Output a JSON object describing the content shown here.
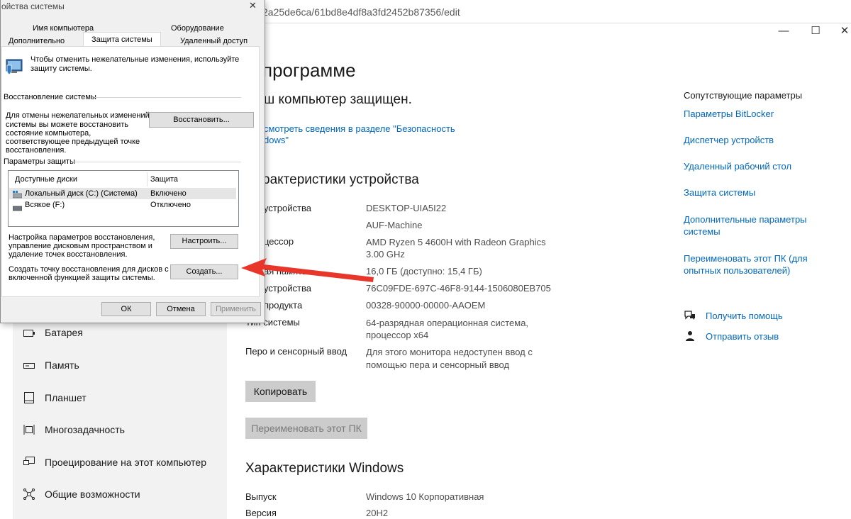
{
  "browser": {
    "url_fragment": "2a25de6ca/61bd8e4df8a3fd2452b87356/edit"
  },
  "window_controls": {
    "minimize": "—",
    "maximize": "☐",
    "close": "✕"
  },
  "about": {
    "title": "программе",
    "protected": "ш компьютер защищен.",
    "security_link_line1": "смотреть сведения в разделе \"Безопасность",
    "security_link_line2": "dows\"",
    "device_specs_title": "рактеристики устройства",
    "specs": [
      {
        "label": "устройства",
        "value": "DESKTOP-UIA5I22"
      },
      {
        "label": "",
        "value": "AUF-Machine"
      },
      {
        "label": "цессор",
        "value": "AMD Ryzen 5 4600H with Radeon Graphics"
      },
      {
        "label": "",
        "value": "3.00 GHz"
      },
      {
        "label": "ая память",
        "value": "16,0 ГБ (доступно: 15,4 ГБ)"
      },
      {
        "label": "устройства",
        "value": "76C09FDE-697C-46F8-9144-1506080EB705"
      },
      {
        "label": "продукта",
        "value": "00328-90000-00000-AAOEM"
      },
      {
        "label": "Тип системы",
        "value": "64-разрядная операционная система,"
      },
      {
        "label": "",
        "value": "процессор x64"
      },
      {
        "label": "Перо и сенсорный ввод",
        "value": "Для этого монитора недоступен ввод с"
      },
      {
        "label": "",
        "value": "помощью пера и сенсорный ввод"
      }
    ],
    "copy_button": "Копировать",
    "rename_button": "Переименовать этот ПК",
    "windows_specs_title": "Характеристики Windows",
    "winspecs": [
      {
        "label": "Выпуск",
        "value": "Windows 10 Корпоративная"
      },
      {
        "label": "Версия",
        "value": "20H2"
      }
    ]
  },
  "related": {
    "title": "Сопутствующие параметры",
    "links": [
      "Параметры BitLocker",
      "Диспетчер устройств",
      "Удаленный рабочий стол",
      "Защита системы",
      "Дополнительные параметры",
      "системы",
      "Переименовать этот ПК (для",
      "опытных пользователей)"
    ],
    "help": "Получить помощь",
    "feedback": "Отправить отзыв"
  },
  "nav": {
    "items": [
      {
        "label": "Батарея",
        "icon": "battery-icon"
      },
      {
        "label": "Память",
        "icon": "storage-icon"
      },
      {
        "label": "Планшет",
        "icon": "tablet-icon"
      },
      {
        "label": "Многозадачность",
        "icon": "multitasking-icon"
      },
      {
        "label": "Проецирование на этот компьютер",
        "icon": "projection-icon"
      },
      {
        "label": "Общие возможности",
        "icon": "shared-experiences-icon"
      }
    ]
  },
  "dialog": {
    "title": "ойства системы",
    "close": "✕",
    "tabs": [
      "Имя компьютера",
      "Оборудование",
      "Дополнительно",
      "Защита системы",
      "Удаленный доступ"
    ],
    "intro_line1": "Чтобы отменить нежелательные изменения, используйте",
    "intro_line2": "защиту системы.",
    "restore_group": "Восстановление системы",
    "restore_text": [
      "Для отмены нежелательных изменений",
      "системы вы можете восстановить",
      "состояние компьютера,",
      "соответствующее предыдущей точке",
      "восстановления."
    ],
    "restore_button": "Восстановить...",
    "protection_group": "Параметры защиты",
    "col_disks": "Доступные диски",
    "col_protection": "Защита",
    "disks": [
      {
        "name": "Локальный диск (C:) (Система)",
        "state": "Включено"
      },
      {
        "name": "Всякое (F:)",
        "state": "Отключено"
      }
    ],
    "configure_text": [
      "Настройка параметров восстановления,",
      "управление дисковым пространством и",
      "удаление точек восстановления."
    ],
    "configure_button": "Настроить...",
    "create_text": [
      "Создать точку восстановления для дисков с",
      "включенной функцией защиты системы."
    ],
    "create_button": "Создать...",
    "ok": "ОК",
    "cancel": "Отмена",
    "apply": "Применить"
  },
  "colors": {
    "accent_link": "#0067c0",
    "arrow": "#e8362a",
    "button_gray": "#cccccc"
  }
}
